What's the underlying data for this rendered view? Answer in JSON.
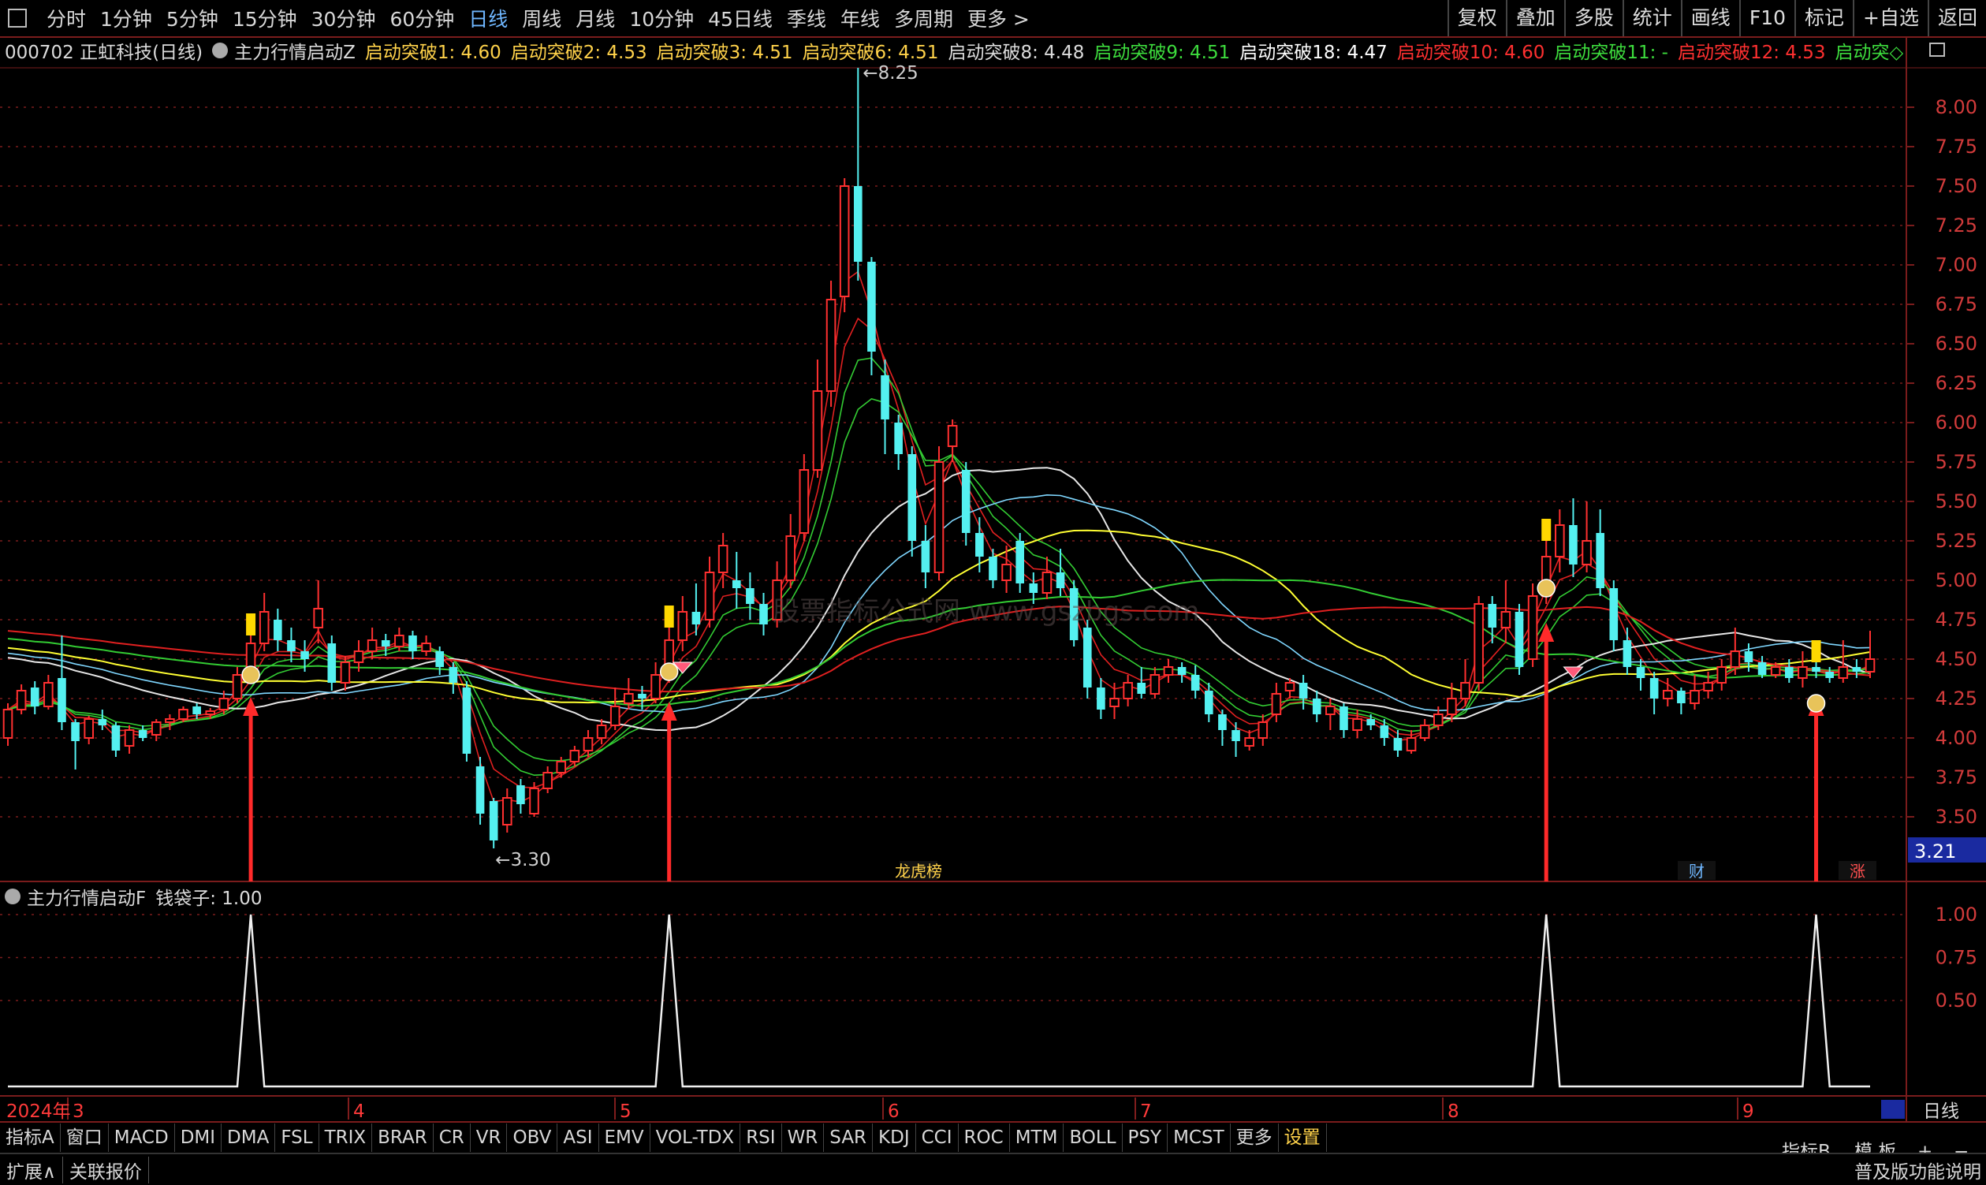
{
  "toolbar": {
    "left_tabs": [
      "分时",
      "1分钟",
      "5分钟",
      "15分钟",
      "30分钟",
      "60分钟",
      "日线",
      "周线",
      "月线",
      "10分钟",
      "45日线",
      "季线",
      "年线",
      "多周期",
      "更多 >"
    ],
    "active_tab": "日线",
    "right_buttons": [
      "复权",
      "叠加",
      "多股",
      "统计",
      "画线",
      "F10",
      "标记",
      "+自选",
      "返回"
    ]
  },
  "header": {
    "stock": "000702 正虹科技(日线)",
    "indicator": "主力行情启动Z",
    "items": [
      {
        "label": "启动突破1: 4.60",
        "color": "#ffd24a"
      },
      {
        "label": "启动突破2: 4.53",
        "color": "#ffd24a"
      },
      {
        "label": "启动突破3: 4.51",
        "color": "#ffd24a"
      },
      {
        "label": "启动突破6: 4.51",
        "color": "#ffd24a"
      },
      {
        "label": "启动突破8: 4.48",
        "color": "#dcdcdc"
      },
      {
        "label": "启动突破9: 4.51",
        "color": "#3ddc3d"
      },
      {
        "label": "启动突破18: 4.47",
        "color": "#ffffff"
      },
      {
        "label": "启动突破10: 4.60",
        "color": "#ff3030"
      },
      {
        "label": "启动突破11: -",
        "color": "#3ddc3d"
      },
      {
        "label": "启动突破12: 4.53",
        "color": "#ff3030"
      },
      {
        "label": "启动突◇",
        "color": "#3ddc3d"
      }
    ]
  },
  "sub_header": {
    "indicator": "主力行情启动F",
    "item": "钱袋子: 1.00"
  },
  "price_axis": [
    "8.00",
    "7.75",
    "7.50",
    "7.25",
    "7.00",
    "6.75",
    "6.50",
    "6.25",
    "6.00",
    "5.75",
    "5.50",
    "5.25",
    "5.00",
    "4.75",
    "4.50",
    "4.25",
    "4.00",
    "3.75",
    "3.50"
  ],
  "current_price_label": "3.21",
  "sub_axis": [
    "1.00",
    "0.75",
    "0.50"
  ],
  "annotations": {
    "high": "8.25",
    "low": "3.30",
    "watermark": "股票指标公式网 www.gszbgs.com",
    "badge_dragon": "龙虎榜",
    "badge_cai": "财",
    "badge_zhang": "涨"
  },
  "date_axis": {
    "year": "2024年",
    "months": [
      "3",
      "4",
      "5",
      "6",
      "7",
      "8",
      "9"
    ]
  },
  "period_label": "日线",
  "bottom_tabs": [
    "指标A",
    "窗口",
    "MACD",
    "DMI",
    "DMA",
    "FSL",
    "TRIX",
    "BRAR",
    "CR",
    "VR",
    "OBV",
    "ASI",
    "EMV",
    "VOL-TDX",
    "RSI",
    "WR",
    "SAR",
    "KDJ",
    "CCI",
    "ROC",
    "MTM",
    "BOLL",
    "PSY",
    "MCST",
    "更多",
    "设置"
  ],
  "bottom_right_tabs": [
    "指标B",
    "模 板",
    "+",
    "−"
  ],
  "status": {
    "expand": "扩展∧",
    "quote": "关联报价",
    "right": "普及版功能说明"
  },
  "colors": {
    "up": "#ff3030",
    "down": "#54f0f0",
    "grid": "#7a1c1c",
    "ma_white": "#e6e6e6",
    "ma_yellow": "#ffff33",
    "ma_green": "#33cc33",
    "ma_red": "#e02020",
    "ma_blue": "#7fd7ff"
  },
  "chart_data": {
    "type": "candlestick",
    "ylim": [
      3.21,
      8.25
    ],
    "high": 8.25,
    "low": 3.3,
    "candles": [
      [
        4.0,
        4.18,
        3.95,
        4.22
      ],
      [
        4.18,
        4.3,
        4.15,
        4.34
      ],
      [
        4.32,
        4.2,
        4.15,
        4.36
      ],
      [
        4.2,
        4.35,
        4.18,
        4.4
      ],
      [
        4.38,
        4.1,
        4.05,
        4.65
      ],
      [
        4.1,
        3.98,
        3.8,
        4.12
      ],
      [
        4.0,
        4.12,
        3.96,
        4.14
      ],
      [
        4.12,
        4.08,
        4.05,
        4.18
      ],
      [
        4.08,
        3.92,
        3.88,
        4.1
      ],
      [
        3.95,
        4.05,
        3.9,
        4.08
      ],
      [
        4.05,
        4.0,
        3.98,
        4.08
      ],
      [
        4.02,
        4.1,
        3.98,
        4.12
      ],
      [
        4.1,
        4.12,
        4.05,
        4.15
      ],
      [
        4.12,
        4.18,
        4.1,
        4.2
      ],
      [
        4.2,
        4.15,
        4.12,
        4.22
      ],
      [
        4.15,
        4.17,
        4.12,
        4.19
      ],
      [
        4.18,
        4.25,
        4.15,
        4.3
      ],
      [
        4.25,
        4.4,
        4.22,
        4.45
      ],
      [
        4.4,
        4.6,
        4.38,
        4.65
      ],
      [
        4.6,
        4.8,
        4.55,
        4.92
      ],
      [
        4.75,
        4.62,
        4.55,
        4.82
      ],
      [
        4.62,
        4.55,
        4.48,
        4.7
      ],
      [
        4.55,
        4.5,
        4.42,
        4.62
      ],
      [
        4.7,
        4.82,
        4.6,
        5.0
      ],
      [
        4.6,
        4.35,
        4.3,
        4.65
      ],
      [
        4.35,
        4.48,
        4.3,
        4.52
      ],
      [
        4.48,
        4.55,
        4.42,
        4.62
      ],
      [
        4.55,
        4.62,
        4.5,
        4.7
      ],
      [
        4.62,
        4.58,
        4.52,
        4.66
      ],
      [
        4.58,
        4.65,
        4.55,
        4.7
      ],
      [
        4.65,
        4.55,
        4.5,
        4.68
      ],
      [
        4.55,
        4.6,
        4.52,
        4.65
      ],
      [
        4.55,
        4.45,
        4.4,
        4.58
      ],
      [
        4.45,
        4.35,
        4.28,
        4.48
      ],
      [
        4.32,
        3.9,
        3.85,
        4.36
      ],
      [
        3.82,
        3.52,
        3.45,
        3.88
      ],
      [
        3.6,
        3.35,
        3.3,
        3.62
      ],
      [
        3.45,
        3.62,
        3.4,
        3.68
      ],
      [
        3.7,
        3.58,
        3.52,
        3.74
      ],
      [
        3.52,
        3.68,
        3.5,
        3.72
      ],
      [
        3.68,
        3.78,
        3.65,
        3.82
      ],
      [
        3.78,
        3.85,
        3.75,
        3.88
      ],
      [
        3.85,
        3.92,
        3.82,
        3.95
      ],
      [
        3.92,
        4.0,
        3.88,
        4.05
      ],
      [
        4.0,
        4.08,
        3.96,
        4.12
      ],
      [
        4.08,
        4.2,
        4.05,
        4.32
      ],
      [
        4.22,
        4.28,
        4.18,
        4.38
      ],
      [
        4.28,
        4.25,
        4.18,
        4.33
      ],
      [
        4.25,
        4.4,
        4.22,
        4.48
      ],
      [
        4.4,
        4.62,
        4.35,
        4.7
      ],
      [
        4.62,
        4.8,
        4.55,
        4.9
      ],
      [
        4.8,
        4.72,
        4.65,
        4.98
      ],
      [
        4.75,
        5.05,
        4.7,
        5.15
      ],
      [
        5.05,
        5.22,
        4.95,
        5.3
      ],
      [
        5.0,
        4.95,
        4.82,
        5.18
      ],
      [
        4.95,
        4.85,
        4.75,
        5.05
      ],
      [
        4.85,
        4.72,
        4.65,
        4.92
      ],
      [
        4.75,
        5.0,
        4.7,
        5.12
      ],
      [
        5.0,
        5.28,
        4.95,
        5.42
      ],
      [
        5.3,
        5.7,
        5.25,
        5.8
      ],
      [
        5.7,
        6.2,
        5.65,
        6.4
      ],
      [
        6.2,
        6.78,
        6.1,
        6.9
      ],
      [
        6.8,
        7.5,
        6.7,
        7.55
      ],
      [
        7.5,
        7.02,
        6.9,
        8.25
      ],
      [
        7.02,
        6.45,
        6.3,
        7.05
      ],
      [
        6.3,
        6.02,
        5.8,
        6.4
      ],
      [
        6.0,
        5.8,
        5.7,
        6.05
      ],
      [
        5.8,
        5.25,
        5.15,
        5.85
      ],
      [
        5.25,
        5.05,
        4.95,
        5.35
      ],
      [
        5.05,
        5.75,
        5.0,
        5.85
      ],
      [
        5.85,
        5.98,
        5.75,
        6.02
      ],
      [
        5.7,
        5.3,
        5.22,
        5.75
      ],
      [
        5.3,
        5.15,
        5.05,
        5.4
      ],
      [
        5.15,
        5.0,
        4.95,
        5.2
      ],
      [
        5.0,
        5.1,
        4.92,
        5.22
      ],
      [
        5.25,
        4.98,
        4.92,
        5.3
      ],
      [
        4.98,
        4.92,
        4.85,
        5.05
      ],
      [
        4.92,
        5.05,
        4.88,
        5.15
      ],
      [
        5.05,
        4.95,
        4.9,
        5.2
      ],
      [
        4.95,
        4.62,
        4.58,
        5.0
      ],
      [
        4.7,
        4.32,
        4.25,
        4.75
      ],
      [
        4.32,
        4.18,
        4.12,
        4.38
      ],
      [
        4.2,
        4.25,
        4.12,
        4.35
      ],
      [
        4.25,
        4.35,
        4.2,
        4.4
      ],
      [
        4.35,
        4.28,
        4.25,
        4.45
      ],
      [
        4.28,
        4.4,
        4.25,
        4.45
      ],
      [
        4.4,
        4.45,
        4.35,
        4.5
      ],
      [
        4.45,
        4.4,
        4.35,
        4.48
      ],
      [
        4.4,
        4.3,
        4.25,
        4.46
      ],
      [
        4.3,
        4.15,
        4.1,
        4.35
      ],
      [
        4.15,
        4.05,
        3.95,
        4.18
      ],
      [
        4.05,
        3.98,
        3.88,
        4.1
      ],
      [
        3.95,
        4.0,
        3.92,
        4.05
      ],
      [
        4.0,
        4.1,
        3.95,
        4.15
      ],
      [
        4.15,
        4.28,
        4.1,
        4.35
      ],
      [
        4.3,
        4.35,
        4.25,
        4.38
      ],
      [
        4.35,
        4.25,
        4.18,
        4.4
      ],
      [
        4.25,
        4.15,
        4.1,
        4.3
      ],
      [
        4.15,
        4.2,
        4.05,
        4.25
      ],
      [
        4.2,
        4.05,
        4.0,
        4.22
      ],
      [
        4.05,
        4.12,
        4.0,
        4.18
      ],
      [
        4.12,
        4.08,
        4.05,
        4.15
      ],
      [
        4.08,
        4.0,
        3.95,
        4.12
      ],
      [
        4.0,
        3.92,
        3.88,
        4.05
      ],
      [
        3.92,
        4.0,
        3.9,
        4.05
      ],
      [
        4.0,
        4.08,
        3.98,
        4.12
      ],
      [
        4.08,
        4.15,
        4.05,
        4.2
      ],
      [
        4.15,
        4.25,
        4.1,
        4.35
      ],
      [
        4.25,
        4.35,
        4.2,
        4.5
      ],
      [
        4.35,
        4.85,
        4.3,
        4.9
      ],
      [
        4.85,
        4.7,
        4.6,
        4.9
      ],
      [
        4.7,
        4.8,
        4.6,
        5.0
      ],
      [
        4.8,
        4.45,
        4.4,
        4.85
      ],
      [
        4.5,
        4.9,
        4.45,
        4.98
      ],
      [
        4.9,
        5.15,
        4.85,
        5.25
      ],
      [
        5.15,
        5.35,
        5.05,
        5.45
      ],
      [
        5.35,
        5.1,
        5.02,
        5.52
      ],
      [
        5.1,
        5.25,
        5.05,
        5.5
      ],
      [
        5.3,
        4.95,
        4.9,
        5.45
      ],
      [
        4.95,
        4.62,
        4.55,
        5.0
      ],
      [
        4.62,
        4.45,
        4.4,
        4.7
      ],
      [
        4.45,
        4.38,
        4.3,
        4.5
      ],
      [
        4.38,
        4.25,
        4.15,
        4.42
      ],
      [
        4.25,
        4.3,
        4.2,
        4.38
      ],
      [
        4.3,
        4.22,
        4.15,
        4.32
      ],
      [
        4.22,
        4.3,
        4.18,
        4.4
      ],
      [
        4.3,
        4.35,
        4.25,
        4.42
      ],
      [
        4.35,
        4.45,
        4.3,
        4.5
      ],
      [
        4.45,
        4.55,
        4.4,
        4.7
      ],
      [
        4.55,
        4.48,
        4.42,
        4.6
      ],
      [
        4.48,
        4.4,
        4.38,
        4.52
      ],
      [
        4.4,
        4.45,
        4.38,
        4.48
      ],
      [
        4.45,
        4.38,
        4.35,
        4.5
      ],
      [
        4.38,
        4.45,
        4.32,
        4.55
      ],
      [
        4.45,
        4.42,
        4.38,
        4.48
      ],
      [
        4.42,
        4.38,
        4.35,
        4.45
      ],
      [
        4.38,
        4.45,
        4.35,
        4.62
      ],
      [
        4.45,
        4.42,
        4.38,
        4.5
      ],
      [
        4.42,
        4.5,
        4.38,
        4.68
      ]
    ],
    "signal_index": [
      18,
      49,
      114,
      134
    ],
    "subchart": {
      "name": "钱袋子",
      "value": 1.0
    }
  }
}
